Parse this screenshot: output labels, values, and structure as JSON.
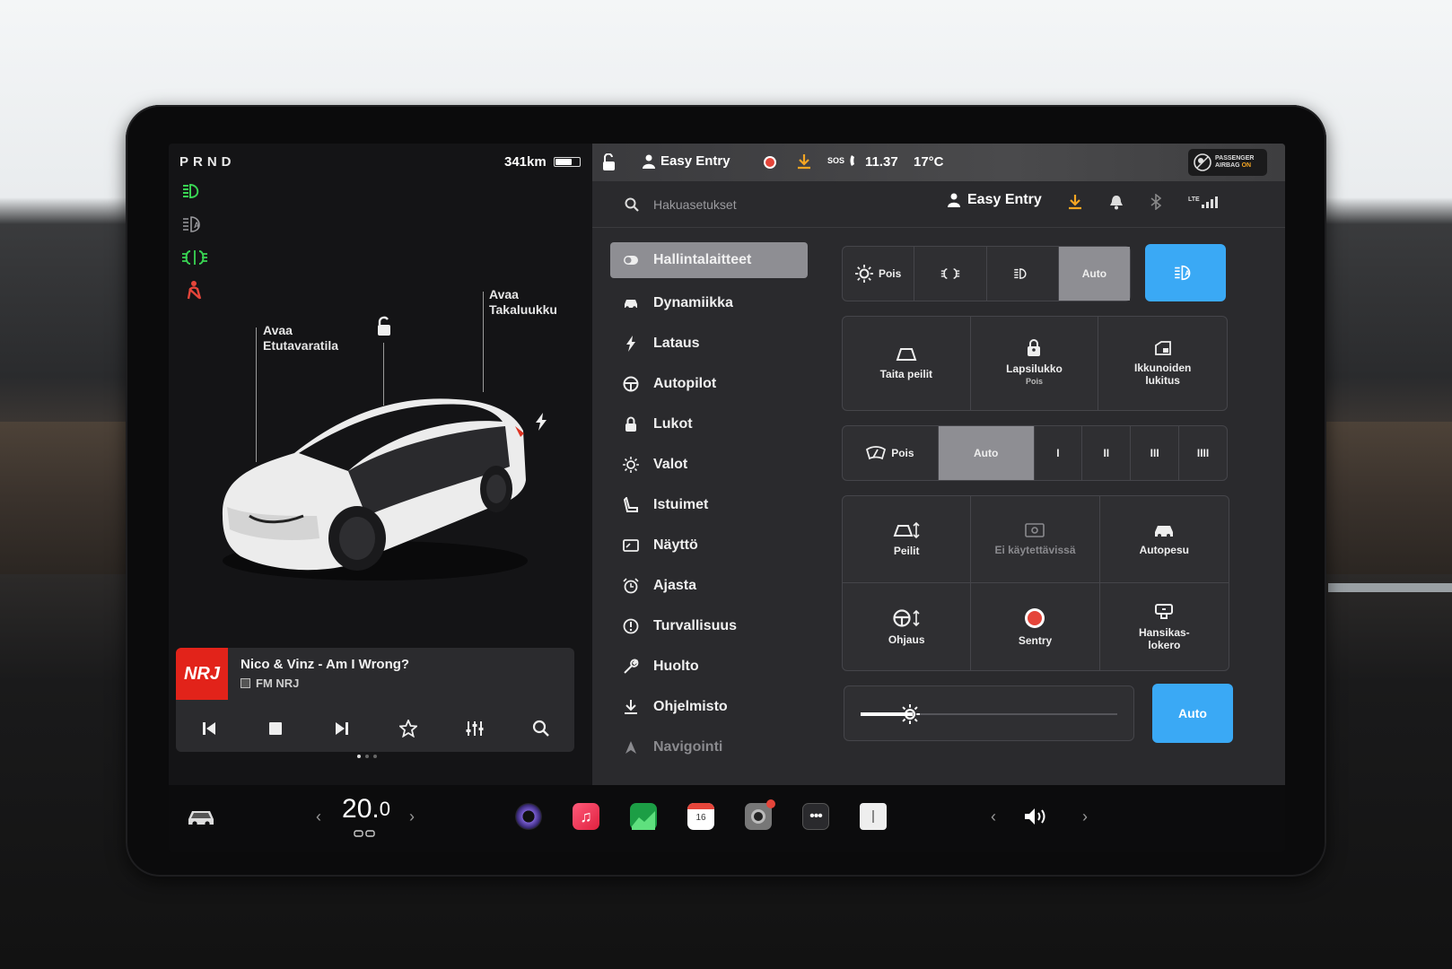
{
  "left": {
    "gear": "PRND",
    "range": "341km",
    "battery_level": 0.7,
    "telltales": [
      "headlight-on-icon",
      "auto-high-beam-icon",
      "fog-light-icon",
      "seatbelt-warning-icon"
    ],
    "front_trunk_label_1": "Avaa",
    "front_trunk_label_2": "Etutavaratila",
    "rear_trunk_label_1": "Avaa",
    "rear_trunk_label_2": "Takaluukku"
  },
  "media": {
    "art_text": "NRJ",
    "title": "Nico & Vinz - Am I Wrong?",
    "station": "FM NRJ"
  },
  "status": {
    "profile": "Easy Entry",
    "sos": "SOS",
    "time": "11.37",
    "temp": "17°C",
    "airbag_line1": "PASSENGER",
    "airbag_line2": "AIRBAG",
    "airbag_state": "ON"
  },
  "search": {
    "placeholder": "Hakuasetukset",
    "profile": "Easy Entry",
    "network": "LTE"
  },
  "nav": [
    {
      "label": "Hallintalaitteet",
      "icon": "toggle-icon",
      "active": true
    },
    {
      "label": "Dynamiikka",
      "icon": "car-icon"
    },
    {
      "label": "Lataus",
      "icon": "bolt-icon"
    },
    {
      "label": "Autopilot",
      "icon": "steering-wheel-icon"
    },
    {
      "label": "Lukot",
      "icon": "lock-icon"
    },
    {
      "label": "Valot",
      "icon": "sun-icon"
    },
    {
      "label": "Istuimet",
      "icon": "seat-icon"
    },
    {
      "label": "Näyttö",
      "icon": "display-icon"
    },
    {
      "label": "Ajasta",
      "icon": "alarm-clock-icon"
    },
    {
      "label": "Turvallisuus",
      "icon": "info-circle-icon"
    },
    {
      "label": "Huolto",
      "icon": "wrench-icon"
    },
    {
      "label": "Ohjelmisto",
      "icon": "download-icon"
    },
    {
      "label": "Navigointi",
      "icon": "navigation-icon"
    }
  ],
  "lights": {
    "off": "Pois",
    "auto": "Auto"
  },
  "tiles1": {
    "mirrors": "Taita peilit",
    "child_lock": "Lapsilukko",
    "child_lock_state": "Pois",
    "window_lock_1": "Ikkunoiden",
    "window_lock_2": "lukitus"
  },
  "wipers": {
    "off": "Pois",
    "auto": "Auto",
    "l1": "I",
    "l2": "II",
    "l3": "III",
    "l4": "IIII"
  },
  "tiles2": {
    "mirrors": "Peilit",
    "unavailable": "Ei käytettävissä",
    "carwash": "Autopesu",
    "steering": "Ohjaus",
    "sentry": "Sentry",
    "glovebox_1": "Hansikas-",
    "glovebox_2": "lokero"
  },
  "brightness": {
    "auto": "Auto",
    "level": 0.2
  },
  "dock": {
    "temp_main": "20.",
    "temp_dec": "0",
    "calendar_day": "16"
  },
  "colors": {
    "accent_blue": "#3aa9f5",
    "selected_grey": "#8e8e93",
    "telltale_green": "#39d353",
    "warning_red": "#e5453a",
    "download_orange": "#f5a623"
  }
}
